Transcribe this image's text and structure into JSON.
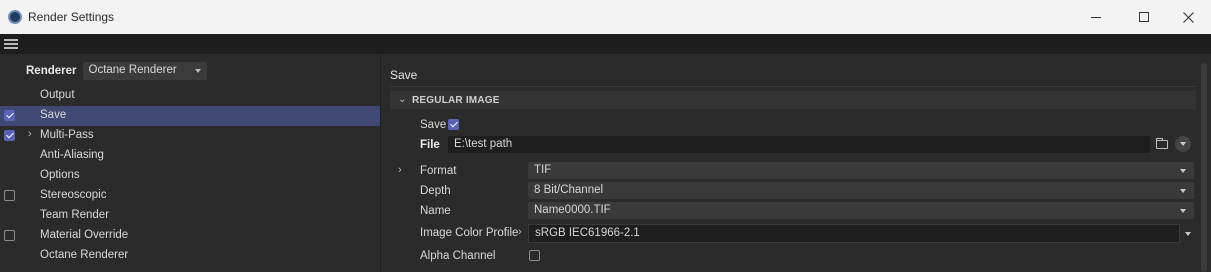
{
  "window": {
    "title": "Render Settings",
    "icon": "cinema4d-icon"
  },
  "left": {
    "renderer_label": "Renderer",
    "renderer_value": "Octane Renderer",
    "items": [
      {
        "label": "Output",
        "checkbox": "none",
        "expandable": false,
        "selected": false
      },
      {
        "label": "Save",
        "checkbox": "checked",
        "expandable": false,
        "selected": true
      },
      {
        "label": "Multi-Pass",
        "checkbox": "checked",
        "expandable": true,
        "selected": false
      },
      {
        "label": "Anti-Aliasing",
        "checkbox": "none",
        "expandable": false,
        "selected": false
      },
      {
        "label": "Options",
        "checkbox": "none",
        "expandable": false,
        "selected": false
      },
      {
        "label": "Stereoscopic",
        "checkbox": "unchecked",
        "expandable": false,
        "selected": false
      },
      {
        "label": "Team Render",
        "checkbox": "none",
        "expandable": false,
        "selected": false
      },
      {
        "label": "Material Override",
        "checkbox": "unchecked",
        "expandable": false,
        "selected": false
      },
      {
        "label": "Octane Renderer",
        "checkbox": "none",
        "expandable": false,
        "selected": false
      }
    ]
  },
  "right": {
    "section_title": "Save",
    "group_label": "REGULAR IMAGE",
    "save_label": "Save",
    "save_checked": true,
    "file_label": "File",
    "file_value": "E:\\test path",
    "format_label": "Format",
    "format_value": "TIF",
    "depth_label": "Depth",
    "depth_value": "8 Bit/Channel",
    "name_label": "Name",
    "name_value": "Name0000.TIF",
    "color_profile_label": "Image Color Profile",
    "color_profile_value": "sRGB IEC61966-2.1",
    "alpha_label": "Alpha Channel",
    "alpha_checked": false
  },
  "colors": {
    "accent": "#5a63b8",
    "selection": "#404873",
    "background": "#2b2b2b"
  }
}
